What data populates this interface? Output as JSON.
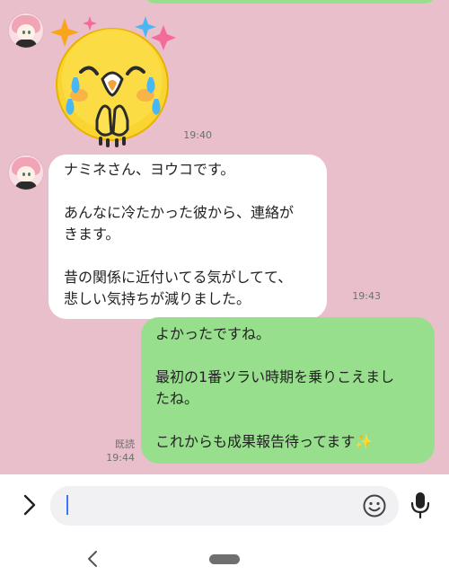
{
  "messages": {
    "sticker": {
      "time": "19:40",
      "icon": "crying-grateful-face-sticker"
    },
    "incoming": {
      "text": "ナミネさん、ヨウコです。\n\nあんなに冷たかった彼から、連絡が\nきます。\n\n昔の関係に近付いてる気がしてて、\n悲しい気持ちが減りました。",
      "time": "19:43"
    },
    "outgoing": {
      "text": "よかったですね。\n\n最初の1番ツラい時期を乗りこえまし\nたね。\n\nこれからも成果報告待ってます✨",
      "read_label": "既読",
      "time": "19:44"
    }
  },
  "input_bar": {
    "expand_icon": "chevron-right-icon",
    "placeholder": "",
    "value": "",
    "emoji_icon": "smiley-icon",
    "mic_icon": "microphone-icon"
  },
  "nav": {
    "back_icon": "back-chevron-icon",
    "home_icon": "home-pill-icon"
  },
  "colors": {
    "chat_background": "#e9bfcc",
    "outgoing_bubble": "#98df8d",
    "incoming_bubble": "#ffffff",
    "cursor": "#3c73ff"
  }
}
